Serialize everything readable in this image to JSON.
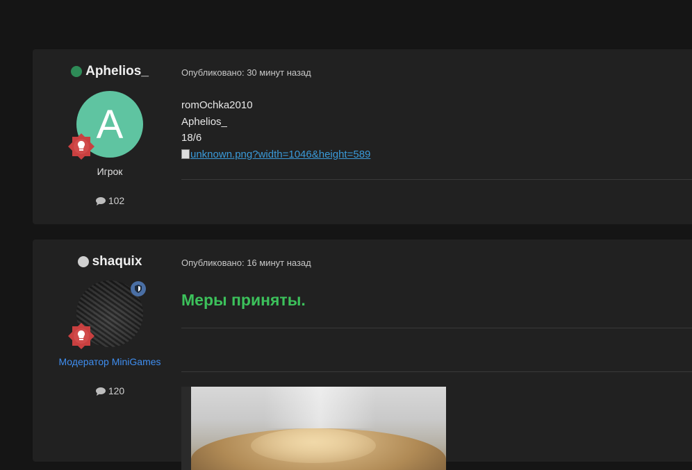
{
  "posts": [
    {
      "username": "Aphelios_",
      "avatar_letter": "A",
      "role": "Игрок",
      "post_count": "102",
      "posted": "Опубликовано: 30 минут назад",
      "lines": [
        "romOchka2010",
        "Aphelios_",
        "18/6"
      ],
      "image_alt": "unknown.png?width=1046&height=589",
      "status_color": "#2e8b57"
    },
    {
      "username": "shaquix",
      "role": "Модератор MiniGames",
      "post_count": "120",
      "posted": "Опубликовано: 16 минут назад",
      "message": "Меры приняты.",
      "status_color": "#cfcfcf"
    }
  ],
  "colors": {
    "background": "#151515",
    "card": "#212121",
    "accent_green": "#3cc15b",
    "moderator_blue": "#3f8ef0",
    "link": "#3a9ad9"
  }
}
